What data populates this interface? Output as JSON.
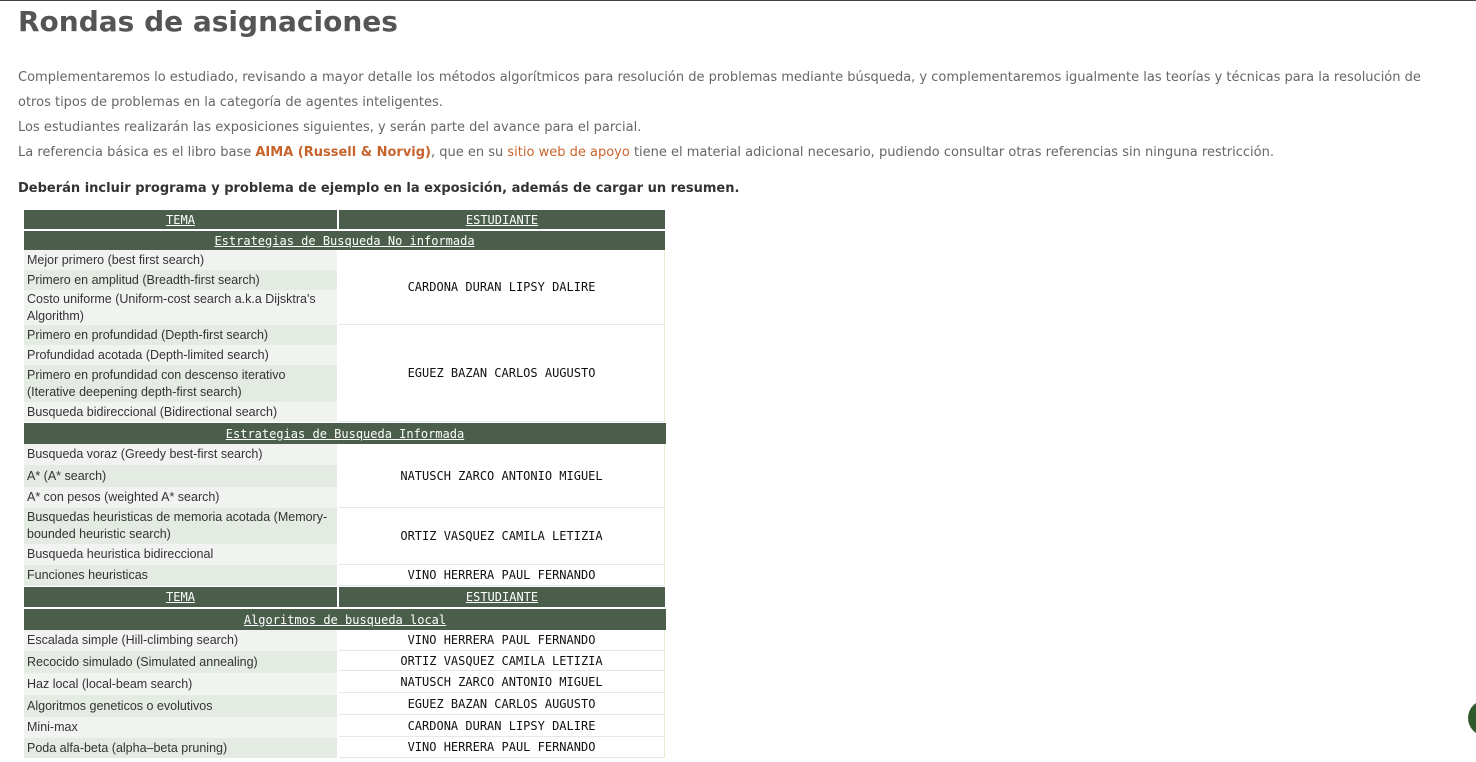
{
  "title": "Rondas de asignaciones",
  "intro": {
    "p1": "Complementaremos lo estudiado, revisando a mayor detalle los métodos algorítmicos para resolución de problemas mediante búsqueda, y complementaremos igualmente las teorías y técnicas para la resolución de otros tipos de problemas en la categoría de agentes inteligentes.",
    "p2": "Los estudiantes realizarán las exposiciones siguientes, y serán parte del avance para el parcial.",
    "p3_a": "La referencia básica es el libro base ",
    "p3_link1": "AIMA (Russell & Norvig)",
    "p3_b": ", que en su ",
    "p3_link2": "sitio web de apoyo",
    "p3_c": " tiene el material adicional necesario, pudiendo consultar otras referencias sin ninguna restricción.",
    "p4": "Deberán incluir programa y problema de ejemplo en la exposición, además de cargar un resumen."
  },
  "table": {
    "header": {
      "topic": "TEMA",
      "student": "ESTUDIANTE"
    },
    "section1": "Estrategias de Busqueda No informada",
    "section2": "Estrategias de Busqueda Informada",
    "section3": "Algoritmos de busqueda local",
    "rows1": [
      "Mejor primero (best first search)",
      "Primero en amplitud (Breadth-first search)",
      "Costo uniforme (Uniform-cost search a.k.a Dijsktra's Algorithm)",
      "Primero en profundidad (Depth-first search)",
      "Profundidad acotada (Depth-limited search)",
      "Primero en profundidad con descenso iterativo (Iterative deepening depth-first search)",
      "Busqueda bidireccional (Bidirectional search)"
    ],
    "students1": [
      "CARDONA DURAN LIPSY DALIRE",
      "EGUEZ BAZAN CARLOS AUGUSTO"
    ],
    "rows2": [
      "Busqueda voraz (Greedy best-first search)",
      "A* (A* search)",
      "A* con pesos (weighted A* search)",
      "Busquedas heuristicas de memoria acotada (Memory-bounded heuristic search)",
      "Busqueda heuristica bidireccional",
      "Funciones heuristicas"
    ],
    "students2": [
      "NATUSCH ZARCO ANTONIO MIGUEL",
      "ORTIZ VASQUEZ CAMILA LETIZIA",
      "VINO HERRERA PAUL FERNANDO"
    ],
    "rows3": [
      {
        "topic": "Escalada simple (Hill-climbing search)",
        "student": "VINO HERRERA PAUL FERNANDO"
      },
      {
        "topic": "Recocido simulado (Simulated annealing)",
        "student": "ORTIZ VASQUEZ CAMILA LETIZIA"
      },
      {
        "topic": "Haz local (local-beam search)",
        "student": "NATUSCH ZARCO ANTONIO MIGUEL"
      },
      {
        "topic": "Algoritmos geneticos o evolutivos",
        "student": "EGUEZ BAZAN CARLOS AUGUSTO"
      },
      {
        "topic": "Mini-max",
        "student": "CARDONA DURAN LIPSY DALIRE"
      },
      {
        "topic": "Poda alfa-beta (alpha–beta pruning)",
        "student": "VINO HERRERA PAUL FERNANDO"
      }
    ]
  }
}
